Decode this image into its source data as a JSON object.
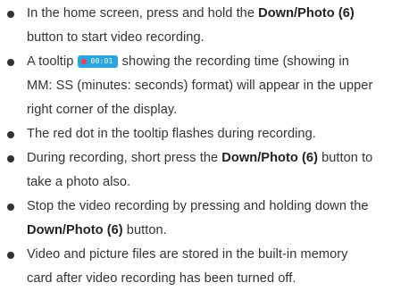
{
  "instructions": {
    "item1": {
      "a": "In the home screen, press and hold the ",
      "b": "Down/Photo (6)",
      "c": " button  to start video recording."
    },
    "item2": {
      "a": "A tooltip ",
      "badge_time": "00:01",
      "b": " showing the recording time (showing in",
      "c": "MM: SS (minutes: seconds) format) will appear in the upper",
      "d": "right corner of the display."
    },
    "item3": {
      "a": "The red dot in the tooltip flashes during recording."
    },
    "item4": {
      "a": "During recording, short press the ",
      "b": "Down/Photo (6)",
      "c": " button to",
      "d": "take a photo also."
    },
    "item5": {
      "a": "Stop the video recording by pressing and holding down the",
      "b": "Down/Photo (6)",
      "c": " button."
    },
    "item6": {
      "a": "Video and picture files are stored in the built-in memory",
      "b": "card after video recording has been turned off."
    }
  },
  "colors": {
    "text": "#333333",
    "badge_background": "#2aa5e6",
    "badge_dot": "#ff3b3b"
  }
}
